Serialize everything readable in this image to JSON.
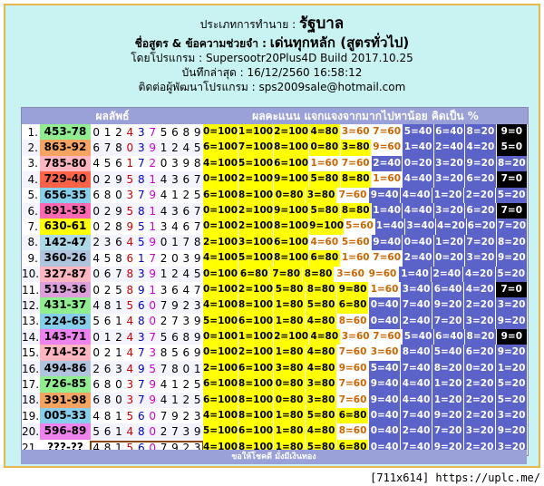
{
  "header": {
    "type_label": "ประเภทการทำนาย :",
    "type_value": "รัฐบาล",
    "formula_label": "ชื่อสูตร & ข้อความช่วยจำ :",
    "formula_value": "เด่นทุกหลัก (สูตรทั่วไป)",
    "program": "โดยโปรแกรม : Supersootr20Plus4D Build 2017.10.25",
    "updated": "บันทึกล่าสุด : 16/12/2560 16:58:12",
    "contact": "ติดต่อผู้พัฒนาโปรแกรม : sps2009sale@hotmail.com"
  },
  "table": {
    "col_result": "ผลลัพธ์",
    "col_scores": "ผลคะแนน แจกแจงจากมากไปหาน้อย คิดเป็น %",
    "rows": [
      {
        "no": "1.",
        "code": "453-78",
        "codebg": "#90ee90",
        "digits": "0124375689",
        "scores": [
          "0=100",
          "1=100",
          "2=100",
          "4=80",
          "3=60",
          "7=60",
          "5=40",
          "6=40",
          "8=20",
          "9=0"
        ]
      },
      {
        "no": "2.",
        "code": "863-92",
        "codebg": "#f4a460",
        "digits": "6780391245",
        "scores": [
          "6=100",
          "7=100",
          "8=100",
          "0=80",
          "3=80",
          "9=60",
          "1=40",
          "2=40",
          "4=20",
          "5=0"
        ]
      },
      {
        "no": "3.",
        "code": "785-80",
        "codebg": "#ffb6c1",
        "digits": "4561720398",
        "scores": [
          "4=100",
          "5=100",
          "6=100",
          "1=60",
          "7=60",
          "2=40",
          "0=20",
          "3=20",
          "9=20",
          "8=20"
        ]
      },
      {
        "no": "4.",
        "code": "729-40",
        "codebg": "#ff6347",
        "digits": "0295814367",
        "scores": [
          "0=100",
          "2=100",
          "9=100",
          "5=80",
          "8=80",
          "1=60",
          "4=40",
          "3=20",
          "6=20",
          "7=0"
        ]
      },
      {
        "no": "5.",
        "code": "656-35",
        "codebg": "#87ceeb",
        "digits": "6803794125",
        "scores": [
          "6=100",
          "8=100",
          "0=80",
          "3=80",
          "7=60",
          "9=40",
          "4=40",
          "1=20",
          "2=20",
          "5=20"
        ]
      },
      {
        "no": "6.",
        "code": "891-53",
        "codebg": "#ff69b4",
        "digits": "0295814367",
        "scores": [
          "0=100",
          "2=100",
          "9=100",
          "5=80",
          "8=80",
          "1=40",
          "4=40",
          "3=20",
          "6=20",
          "7=0"
        ]
      },
      {
        "no": "7.",
        "code": "630-61",
        "codebg": "#ffff00",
        "digits": "0289513467",
        "scores": [
          "0=100",
          "2=100",
          "8=100",
          "9=100",
          "5=60",
          "1=40",
          "3=40",
          "4=20",
          "6=20",
          "7=20"
        ]
      },
      {
        "no": "8.",
        "code": "142-47",
        "codebg": "#add8e6",
        "digits": "2364590178",
        "scores": [
          "2=100",
          "3=100",
          "6=100",
          "4=60",
          "5=60",
          "9=40",
          "0=40",
          "1=20",
          "7=20",
          "8=20"
        ]
      },
      {
        "no": "9.",
        "code": "360-26",
        "codebg": "#b0c4de",
        "digits": "4586172039",
        "scores": [
          "4=100",
          "5=100",
          "8=100",
          "6=80",
          "1=60",
          "7=60",
          "2=40",
          "0=20",
          "3=20",
          "9=20"
        ]
      },
      {
        "no": "10.",
        "code": "327-87",
        "codebg": "#ffb6c1",
        "digits": "0678391245",
        "scores": [
          "0=100",
          "6=80",
          "7=80",
          "8=80",
          "3=60",
          "9=60",
          "1=40",
          "2=40",
          "4=20",
          "5=20"
        ]
      },
      {
        "no": "11.",
        "code": "519-36",
        "codebg": "#dda0dd",
        "digits": "0258913647",
        "scores": [
          "0=100",
          "2=100",
          "5=80",
          "8=80",
          "9=80",
          "1=60",
          "3=40",
          "6=40",
          "4=20",
          "7=0"
        ]
      },
      {
        "no": "12.",
        "code": "431-37",
        "codebg": "#90ee90",
        "digits": "4815607923",
        "scores": [
          "4=100",
          "8=100",
          "1=80",
          "5=80",
          "6=80",
          "0=40",
          "7=40",
          "9=20",
          "2=20",
          "3=20"
        ]
      },
      {
        "no": "13.",
        "code": "224-65",
        "codebg": "#87ceeb",
        "digits": "5614802739",
        "scores": [
          "5=100",
          "6=100",
          "1=80",
          "4=80",
          "8=60",
          "0=40",
          "2=40",
          "7=20",
          "3=20",
          "9=20"
        ]
      },
      {
        "no": "14.",
        "code": "143-71",
        "codebg": "#ee82ee",
        "digits": "0124375689",
        "scores": [
          "0=100",
          "1=100",
          "2=100",
          "4=80",
          "3=60",
          "7=60",
          "5=40",
          "6=40",
          "8=20",
          "9=0"
        ]
      },
      {
        "no": "15.",
        "code": "714-52",
        "codebg": "#ffb6c1",
        "digits": "0214738569",
        "scores": [
          "0=100",
          "2=100",
          "1=80",
          "4=80",
          "7=60",
          "3=60",
          "8=40",
          "5=40",
          "6=20",
          "9=20"
        ]
      },
      {
        "no": "16.",
        "code": "494-86",
        "codebg": "#b0c4de",
        "digits": "2634957801",
        "scores": [
          "2=100",
          "6=100",
          "3=80",
          "4=80",
          "9=60",
          "5=40",
          "7=40",
          "8=20",
          "0=20",
          "1=20"
        ]
      },
      {
        "no": "17.",
        "code": "726-85",
        "codebg": "#90ee90",
        "digits": "6803794125",
        "scores": [
          "6=100",
          "8=100",
          "0=80",
          "3=80",
          "7=60",
          "9=40",
          "4=40",
          "1=20",
          "2=20",
          "5=20"
        ]
      },
      {
        "no": "18.",
        "code": "391-98",
        "codebg": "#f4a460",
        "digits": "6803794125",
        "scores": [
          "6=100",
          "8=100",
          "0=80",
          "3=80",
          "7=60",
          "9=40",
          "4=40",
          "1=20",
          "2=20",
          "5=20"
        ]
      },
      {
        "no": "19.",
        "code": "005-33",
        "codebg": "#87ceeb",
        "digits": "4815607923",
        "scores": [
          "4=100",
          "8=100",
          "1=80",
          "5=80",
          "6=80",
          "0=40",
          "7=40",
          "9=20",
          "2=20",
          "3=20"
        ]
      },
      {
        "no": "20.",
        "code": "596-89",
        "codebg": "#ee82ee",
        "digits": "5614802739",
        "scores": [
          "5=100",
          "6=100",
          "1=80",
          "4=80",
          "8=60",
          "0=40",
          "2=40",
          "7=20",
          "3=20",
          "9=20"
        ]
      },
      {
        "no": "21.",
        "code": "???-??",
        "codebg": "#ffffff",
        "digits": "4815607923",
        "scores": [
          "4=100",
          "8=100",
          "1=80",
          "5=80",
          "6=80",
          "0=40",
          "7=40",
          "9=20",
          "2=20",
          "3=20"
        ]
      }
    ]
  },
  "footer": "ขอให้โชคดี มั่งมีเงินทอง",
  "watermark": "[711x614] https://uplc.me/"
}
